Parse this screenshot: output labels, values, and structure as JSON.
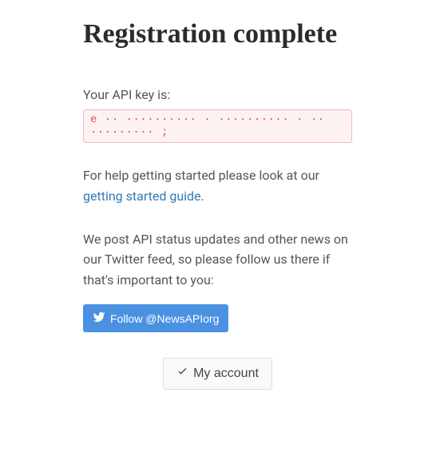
{
  "page": {
    "title": "Registration complete",
    "api_key_label": "Your API key is:",
    "api_key_value": "e  ·· ·········· · ·········· · ·· ·········  ;",
    "help_text_before": "For help getting started please look at our ",
    "help_link_text": "getting started guide",
    "help_text_after": ".",
    "twitter_text": "We post API status updates and other news on our Twitter feed, so please follow us there if that's important to you:",
    "twitter_btn_label": "Follow @NewsAPIorg",
    "account_btn_label": "My account"
  },
  "colors": {
    "link": "#337ab7",
    "twitter_btn": "#4a91e2",
    "api_key_border": "#f2b8bd",
    "api_key_bg": "#fdf2f3",
    "api_key_text": "#d9534f"
  }
}
